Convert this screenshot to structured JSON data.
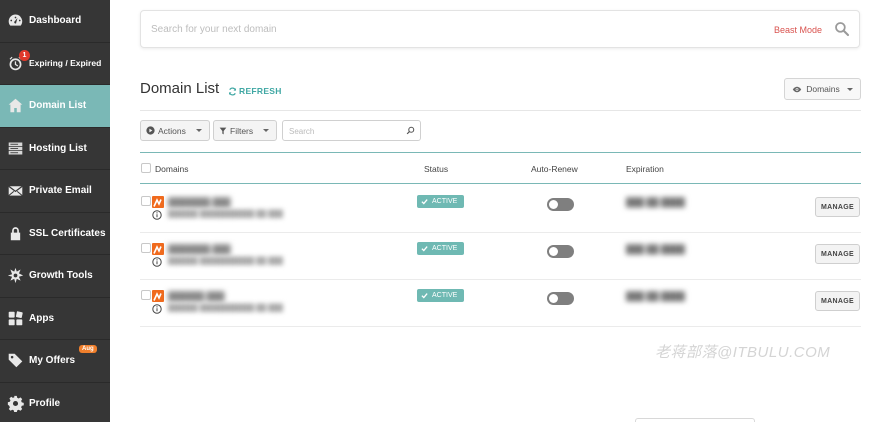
{
  "sidebar": {
    "items": [
      {
        "label": "Dashboard",
        "icon": "speedometer-icon"
      },
      {
        "label": "Expiring / Expired",
        "icon": "alarm-clock-icon",
        "badge": "1"
      },
      {
        "label": "Domain List",
        "icon": "home-icon",
        "active": true
      },
      {
        "label": "Hosting List",
        "icon": "server-icon"
      },
      {
        "label": "Private Email",
        "icon": "envelope-icon"
      },
      {
        "label": "SSL Certificates",
        "icon": "lock-icon"
      },
      {
        "label": "Growth Tools",
        "icon": "gear-burst-icon"
      },
      {
        "label": "Apps",
        "icon": "apps-icon"
      },
      {
        "label": "My Offers",
        "icon": "tag-icon",
        "badge": "Aug"
      },
      {
        "label": "Profile",
        "icon": "cog-icon"
      }
    ]
  },
  "search": {
    "placeholder": "Search for your next domain",
    "beast_mode": "Beast Mode"
  },
  "header": {
    "title": "Domain List",
    "refresh": "REFRESH",
    "domains_dropdown": "Domains"
  },
  "toolbar": {
    "actions": "Actions",
    "filters": "Filters",
    "search_placeholder": "Search"
  },
  "table": {
    "columns": [
      "Domains",
      "Status",
      "Auto-Renew",
      "Expiration"
    ],
    "rows": [
      {
        "domain": "███████.███",
        "sub": "██████ ███████████ ██ ███",
        "status": "ACTIVE",
        "auto_renew": false,
        "expiration": "███ ██ ████",
        "action": "MANAGE"
      },
      {
        "domain": "███████.███",
        "sub": "██████ ███████████ ██ ███",
        "status": "ACTIVE",
        "auto_renew": false,
        "expiration": "███ ██ ████",
        "action": "MANAGE"
      },
      {
        "domain": "██████.███",
        "sub": "██████ ███████████ ██ ███",
        "status": "ACTIVE",
        "auto_renew": false,
        "expiration": "███ ██ ████",
        "action": "MANAGE"
      }
    ]
  },
  "watermark": "老蒋部落@ITBULU.COM",
  "colors": {
    "sidebar_bg": "#363636",
    "active_teal": "#7ab8b6",
    "accent_teal": "#3fa7a3",
    "beast_mode_red": "#d9534f",
    "brand_orange": "#f06a1d"
  }
}
